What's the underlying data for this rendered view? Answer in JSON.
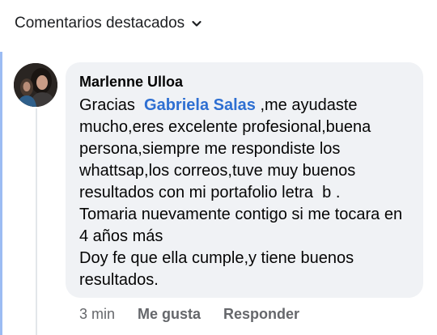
{
  "header": {
    "title": "Comentarios destacados",
    "chevron_icon": "chevron-down-icon"
  },
  "comment": {
    "author": "Marlenne Ulloa",
    "text_before_mention": "Gracias  ",
    "mention": "Gabriela Salas",
    "text_after_mention": " ,me ayudaste mucho,eres excelente profesional,buena persona,siempre me respondiste los whattsap,los correos,tuve muy buenos resultados con mi portafolio letra  b .\nTomaria nuevamente contigo si me tocara en 4 años más\nDoy fe que ella cumple,y tiene buenos resultados.",
    "time": "3 min",
    "like_label": "Me gusta",
    "reply_label": "Responder"
  },
  "colors": {
    "mention": "#2e6fd2",
    "bubble": "#f0f2f5",
    "accent": "#9cbcf3",
    "muted": "#65676b"
  }
}
